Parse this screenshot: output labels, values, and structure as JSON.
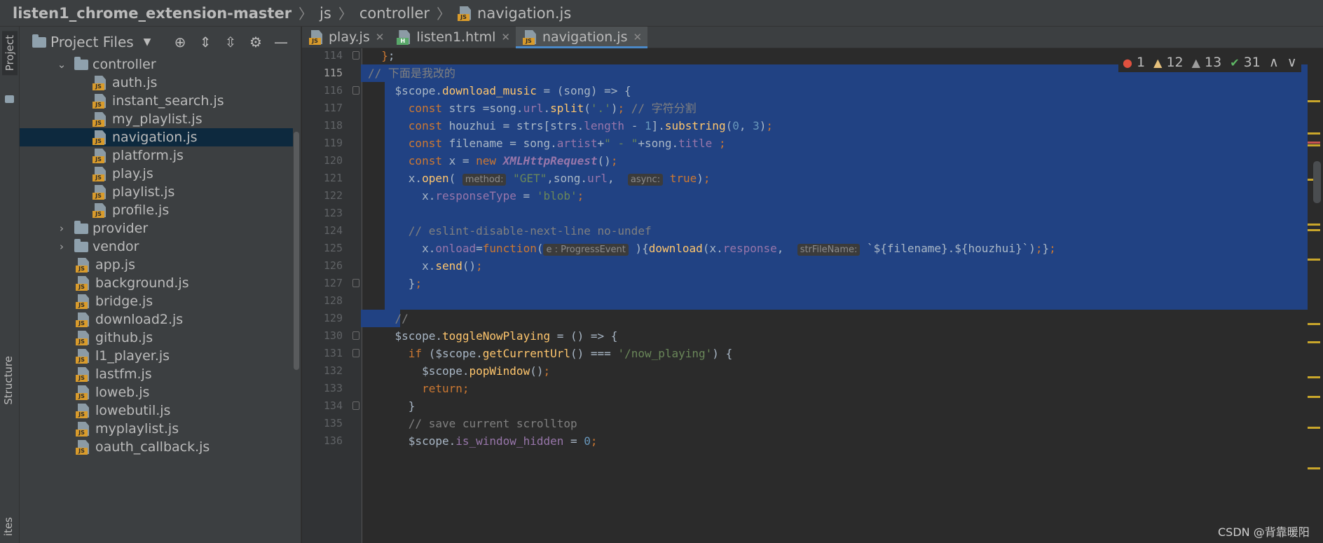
{
  "breadcrumb": {
    "project": "listen1_chrome_extension-master",
    "folder1": "js",
    "folder2": "controller",
    "file": "navigation.js"
  },
  "toolstrip": {
    "project": "Project",
    "structure": "Structure",
    "favorites": "ites"
  },
  "project_panel": {
    "title": "Project Files",
    "tools": [
      "locate-icon",
      "expand-all-icon",
      "collapse-all-icon",
      "gear-icon",
      "minimize-icon"
    ],
    "tree": [
      {
        "label": "controller",
        "type": "folder",
        "expanded": true,
        "depth": 1
      },
      {
        "label": "auth.js",
        "type": "js",
        "depth": 2
      },
      {
        "label": "instant_search.js",
        "type": "js",
        "depth": 2
      },
      {
        "label": "my_playlist.js",
        "type": "js",
        "depth": 2
      },
      {
        "label": "navigation.js",
        "type": "js",
        "depth": 2,
        "selected": true
      },
      {
        "label": "platform.js",
        "type": "js",
        "depth": 2
      },
      {
        "label": "play.js",
        "type": "js",
        "depth": 2
      },
      {
        "label": "playlist.js",
        "type": "js",
        "depth": 2
      },
      {
        "label": "profile.js",
        "type": "js",
        "depth": 2
      },
      {
        "label": "provider",
        "type": "folder",
        "expanded": false,
        "depth": 1
      },
      {
        "label": "vendor",
        "type": "folder",
        "expanded": false,
        "depth": 1
      },
      {
        "label": "app.js",
        "type": "js",
        "depth": 1
      },
      {
        "label": "background.js",
        "type": "js",
        "depth": 1
      },
      {
        "label": "bridge.js",
        "type": "js",
        "depth": 1
      },
      {
        "label": "download2.js",
        "type": "js",
        "depth": 1
      },
      {
        "label": "github.js",
        "type": "js",
        "depth": 1
      },
      {
        "label": "l1_player.js",
        "type": "js",
        "depth": 1
      },
      {
        "label": "lastfm.js",
        "type": "js",
        "depth": 1
      },
      {
        "label": "loweb.js",
        "type": "js",
        "depth": 1
      },
      {
        "label": "lowebutil.js",
        "type": "js",
        "depth": 1
      },
      {
        "label": "myplaylist.js",
        "type": "js",
        "depth": 1
      },
      {
        "label": "oauth_callback.js",
        "type": "js",
        "depth": 1
      }
    ]
  },
  "tabs": [
    {
      "label": "play.js",
      "type": "js",
      "active": false
    },
    {
      "label": "listen1.html",
      "type": "html",
      "active": false
    },
    {
      "label": "navigation.js",
      "type": "js",
      "active": true
    }
  ],
  "inspections": {
    "errors": "1",
    "warnings": "12",
    "weak_warnings": "13",
    "ok": "31"
  },
  "editor": {
    "lines": [
      {
        "n": "114",
        "fold": true,
        "html": "  <span class=\"kw\">}</span>;"
      },
      {
        "n": "115",
        "current": true,
        "sel": "full",
        "html": "<span class=\"cmt\">// 下面是我改的</span>"
      },
      {
        "n": "116",
        "fold": true,
        "sel": "full",
        "html": "    $scope.<span class=\"fn\">download_music</span> = (song) => {"
      },
      {
        "n": "117",
        "sel": "full",
        "html": "      <span class=\"kw\">const</span> strs =song.<span class=\"prop\">url</span>.<span class=\"fn\">split</span>(<span class=\"str\">'.'</span>)<span class=\"kw\">;</span> <span class=\"cmt\">// 字符分割</span>"
      },
      {
        "n": "118",
        "sel": "full",
        "html": "      <span class=\"kw\">const</span> houzhui = strs[strs.<span class=\"prop\">length</span> - <span class=\"num\">1</span>].<span class=\"fn\">substring</span>(<span class=\"num\">0</span>, <span class=\"num\">3</span>)<span class=\"kw\">;</span>"
      },
      {
        "n": "119",
        "sel": "full",
        "html": "      <span class=\"kw\">const</span> filename = song.<span class=\"prop\">artist</span>+<span class=\"str\">\" - \"</span>+song.<span class=\"prop\">title</span> <span class=\"kw\">;</span>"
      },
      {
        "n": "120",
        "sel": "full",
        "html": "      <span class=\"kw\">const</span> x = <span class=\"kw\">new</span> <span class=\"cls\">XMLHttpRequest</span>()<span class=\"kw\">;</span>"
      },
      {
        "n": "121",
        "sel": "full",
        "html": "      x.<span class=\"fn\">open</span>( <span class=\"hint\">method:</span> <span class=\"str\">\"GET\"</span>,song.<span class=\"prop\">url</span>,  <span class=\"hint\">async:</span> <span class=\"kw\">true</span>)<span class=\"kw\">;</span>"
      },
      {
        "n": "122",
        "sel": "full",
        "html": "        x.<span class=\"prop\">responseType</span> = <span class=\"str\">'blob'</span><span class=\"kw\">;</span>"
      },
      {
        "n": "123",
        "sel": "full",
        "html": ""
      },
      {
        "n": "124",
        "sel": "full",
        "html": "      <span class=\"cmt\">// eslint-disable-next-line no-undef</span>"
      },
      {
        "n": "125",
        "sel": "full",
        "html": "        x.<span class=\"prop\">onload</span>=<span class=\"kw\">function</span>(<span class=\"hint\">e : ProgressEvent</span> ){<span class=\"fn\">download</span>(x.<span class=\"prop\">response</span>,  <span class=\"hint\">strFileName:</span> `${filename}.${houzhui}`)<span class=\"kw\">;</span>}<span class=\"kw\">;</span>"
      },
      {
        "n": "126",
        "sel": "full",
        "html": "        x.<span class=\"fn\">send</span>()<span class=\"kw\">;</span>"
      },
      {
        "n": "127",
        "fold": true,
        "sel": "full",
        "html": "      }<span class=\"kw\">;</span>"
      },
      {
        "n": "128",
        "sel": "full",
        "html": ""
      },
      {
        "n": "129",
        "sel": "partial",
        "html": "    <span class=\"cmt\">//</span>"
      },
      {
        "n": "130",
        "fold": true,
        "html": "    $scope.<span class=\"fn\">toggleNowPlaying</span> = () => {"
      },
      {
        "n": "131",
        "fold": true,
        "html": "      <span class=\"kw\">if</span> ($scope.<span class=\"fn\">getCurrentUrl</span>() === <span class=\"str\">'/now_playing'</span>) {"
      },
      {
        "n": "132",
        "html": "        $scope.<span class=\"fn\">popWindow</span>()<span class=\"kw\">;</span>"
      },
      {
        "n": "133",
        "html": "        <span class=\"kw\">return;</span>"
      },
      {
        "n": "134",
        "fold": true,
        "html": "      }"
      },
      {
        "n": "135",
        "html": "      <span class=\"cmt\">// save current scrolltop</span>"
      },
      {
        "n": "136",
        "html": "      $scope.<span class=\"prop\">is_window_hidden</span> = <span class=\"num\">0</span><span class=\"kw\">;</span>"
      }
    ]
  },
  "watermark": "CSDN @背靠暖阳",
  "colors": {
    "selection": "#214283",
    "accent": "#4a88c7",
    "error": "#c75450",
    "warning": "#c9a62b"
  }
}
